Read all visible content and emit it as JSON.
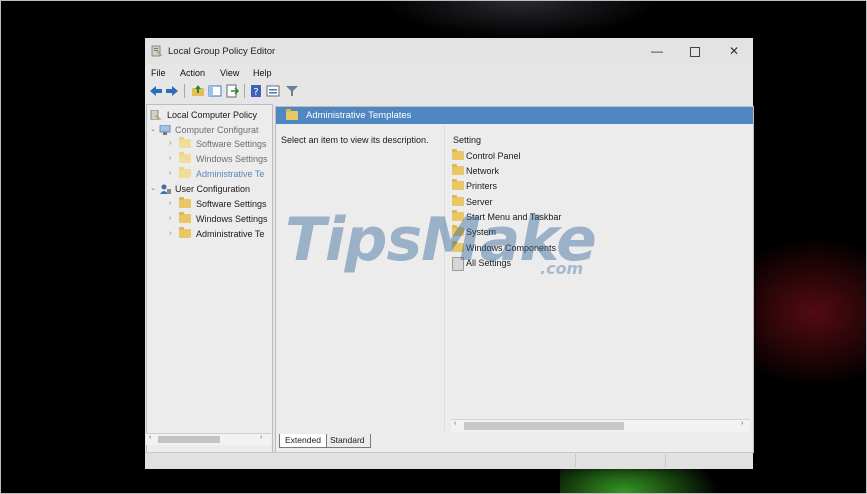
{
  "window": {
    "title": "Local Group Policy Editor",
    "minimize_glyph": "—",
    "close_glyph": "✕"
  },
  "menu": [
    "File",
    "Action",
    "View",
    "Help"
  ],
  "toolbar": {
    "icons": [
      "back-arrow-icon",
      "forward-arrow-icon",
      "up-folder-icon",
      "show-hide-tree-icon",
      "export-list-icon",
      "help-icon",
      "properties-icon",
      "filter-icon"
    ]
  },
  "tree": {
    "root": "Local Computer Policy",
    "computer_config": "Computer Configurat",
    "computer_children": [
      "Software Settings",
      "Windows Settings",
      "Administrative Te"
    ],
    "user_config": "User Configuration",
    "user_children": [
      "Software Settings",
      "Windows Settings",
      "Administrative Te"
    ]
  },
  "right": {
    "header": "Administrative Templates",
    "description": "Select an item to view its description.",
    "column": "Setting",
    "items": [
      "Control Panel",
      "Network",
      "Printers",
      "Server",
      "Start Menu and Taskbar",
      "System",
      "Windows Components",
      "All Settings"
    ]
  },
  "tabs": [
    "Extended",
    "Standard"
  ],
  "watermark": {
    "text": "TipsMake",
    "suffix": ".com"
  },
  "colors": {
    "header_blue": "#4f87c2",
    "folder_yellow": "#e8c766",
    "window_bg": "#e6e6e6",
    "watermark": "#285f96"
  }
}
